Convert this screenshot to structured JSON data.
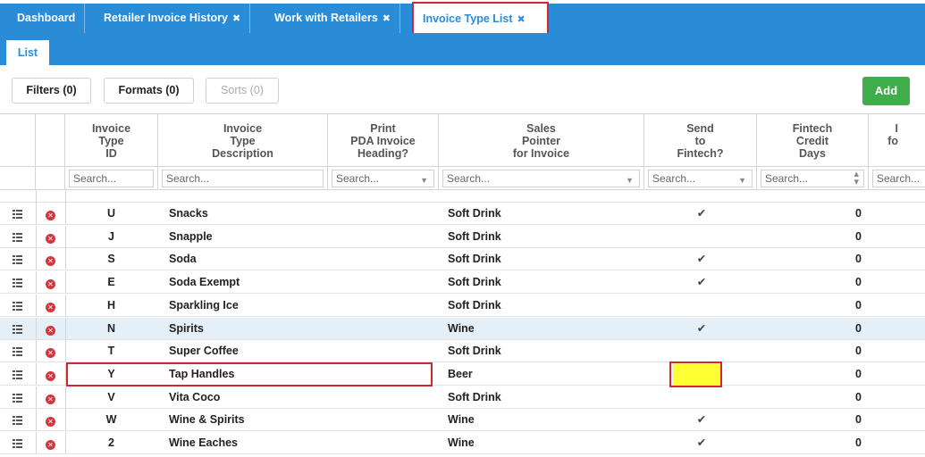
{
  "top_tabs": [
    {
      "label": "Dashboard",
      "closable": false
    },
    {
      "label": "Retailer Invoice History",
      "closable": true
    },
    {
      "label": "Work with Retailers",
      "closable": true
    },
    {
      "label": "Invoice Type List",
      "closable": true,
      "active": true
    }
  ],
  "close_glyph": "✖",
  "sub_tab": {
    "label": "List"
  },
  "toolbar": {
    "filters_label": "Filters (0)",
    "formats_label": "Formats (0)",
    "sorts_label": "Sorts (0)",
    "add_label": "Add"
  },
  "columns": [
    {
      "key": "id",
      "header": [
        "Invoice",
        "Type",
        "ID"
      ]
    },
    {
      "key": "desc",
      "header": [
        "Invoice",
        "Type",
        "Description"
      ]
    },
    {
      "key": "print",
      "header": [
        "Print",
        "PDA Invoice",
        "Heading?"
      ]
    },
    {
      "key": "pointer",
      "header": [
        "Sales",
        "Pointer",
        "for Invoice"
      ]
    },
    {
      "key": "send",
      "header": [
        "Send",
        "to",
        "Fintech?"
      ]
    },
    {
      "key": "days",
      "header": [
        "Fintech",
        "Credit",
        "Days"
      ]
    },
    {
      "key": "more",
      "header": [
        "I",
        "fo",
        ""
      ]
    }
  ],
  "search_placeholder": "Search...",
  "check_glyph": "✔",
  "rows": [
    {
      "id": "U",
      "desc": "Snacks",
      "pointer": "Soft Drink",
      "send": true,
      "days": "0"
    },
    {
      "id": "J",
      "desc": "Snapple",
      "pointer": "Soft Drink",
      "send": false,
      "days": "0"
    },
    {
      "id": "S",
      "desc": "Soda",
      "pointer": "Soft Drink",
      "send": true,
      "days": "0"
    },
    {
      "id": "E",
      "desc": "Soda Exempt",
      "pointer": "Soft Drink",
      "send": true,
      "days": "0"
    },
    {
      "id": "H",
      "desc": "Sparkling Ice",
      "pointer": "Soft Drink",
      "send": false,
      "days": "0"
    },
    {
      "id": "N",
      "desc": "Spirits",
      "pointer": "Wine",
      "send": true,
      "days": "0",
      "highlighted": true
    },
    {
      "id": "T",
      "desc": "Super Coffee",
      "pointer": "Soft Drink",
      "send": false,
      "days": "0"
    },
    {
      "id": "Y",
      "desc": "Tap Handles",
      "pointer": "Beer",
      "send": false,
      "days": "0",
      "selected": true
    },
    {
      "id": "V",
      "desc": "Vita Coco",
      "pointer": "Soft Drink",
      "send": false,
      "days": "0"
    },
    {
      "id": "W",
      "desc": "Wine & Spirits",
      "pointer": "Wine",
      "send": true,
      "days": "0"
    },
    {
      "id": "2",
      "desc": "Wine Eaches",
      "pointer": "Wine",
      "send": true,
      "days": "0"
    }
  ],
  "colors": {
    "header_blue": "#2a8bd6",
    "add_green": "#3fae4a",
    "highlight_red": "#d3262f",
    "yellow_marker": "#ffff33",
    "row_highlight": "#e4eff8"
  }
}
